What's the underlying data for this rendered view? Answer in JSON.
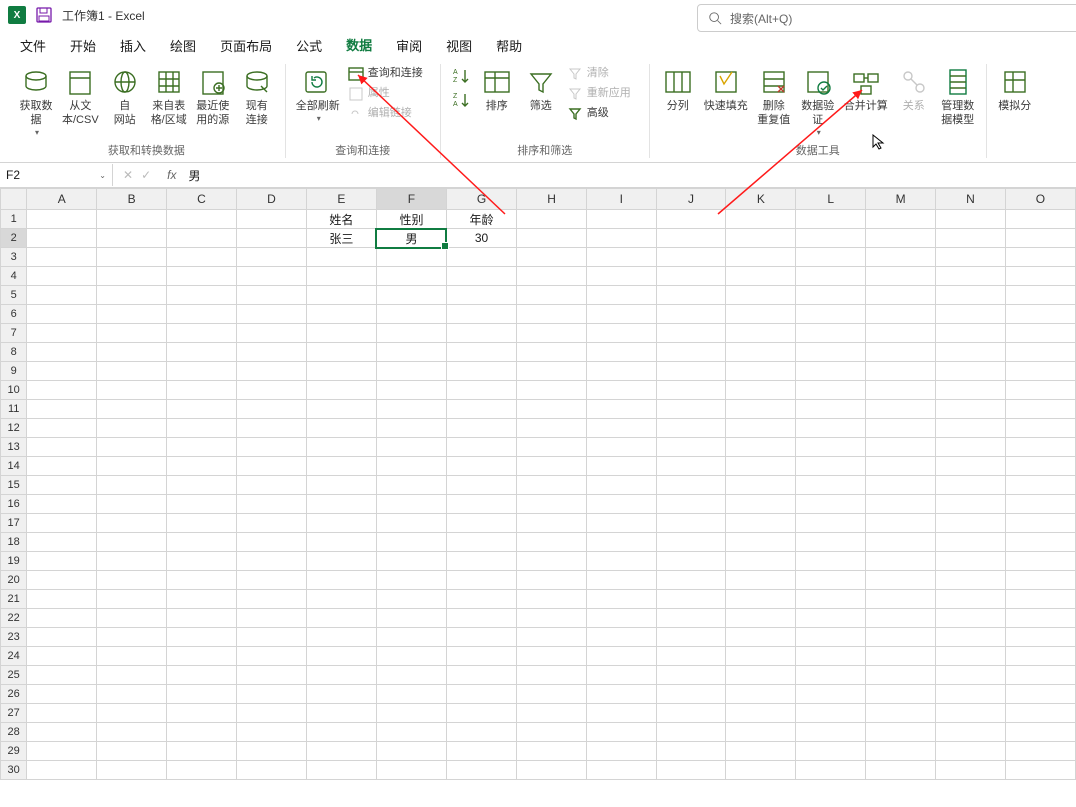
{
  "title": "工作簿1 - Excel",
  "search": {
    "placeholder": "搜索(Alt+Q)"
  },
  "tabs": [
    "文件",
    "开始",
    "插入",
    "绘图",
    "页面布局",
    "公式",
    "数据",
    "审阅",
    "视图",
    "帮助"
  ],
  "activeTab": "数据",
  "ribbon": {
    "g1": {
      "label": "获取和转换数据",
      "cmds": [
        "获取数\n据",
        "从文\n本/CSV",
        "自\n网站",
        "来自表\n格/区域",
        "最近使\n用的源",
        "现有\n连接"
      ]
    },
    "g2": {
      "label": "查询和连接",
      "refresh": "全部刷新",
      "sub": [
        "查询和连接",
        "属性",
        "编辑链接"
      ]
    },
    "g3": {
      "label": "排序和筛选",
      "sort": "排序",
      "filter": "筛选",
      "sub": [
        "清除",
        "重新应用",
        "高级"
      ]
    },
    "g4": {
      "label": "数据工具",
      "cmds": [
        "分列",
        "快速填充",
        "删除\n重复值",
        "数据验\n证",
        "合并计算",
        "关系",
        "管理数\n据模型"
      ]
    },
    "g5": {
      "cmds": [
        "模拟分"
      ]
    }
  },
  "namebox": "F2",
  "formula_value": "男",
  "columns": [
    "A",
    "B",
    "C",
    "D",
    "E",
    "F",
    "G",
    "H",
    "I",
    "J",
    "K",
    "L",
    "M",
    "N",
    "O"
  ],
  "rows": 30,
  "data": {
    "E1": "姓名",
    "F1": "性别",
    "G1": "年龄",
    "E2": "张三",
    "F2": "男",
    "G2": "30"
  },
  "selected": "F2"
}
